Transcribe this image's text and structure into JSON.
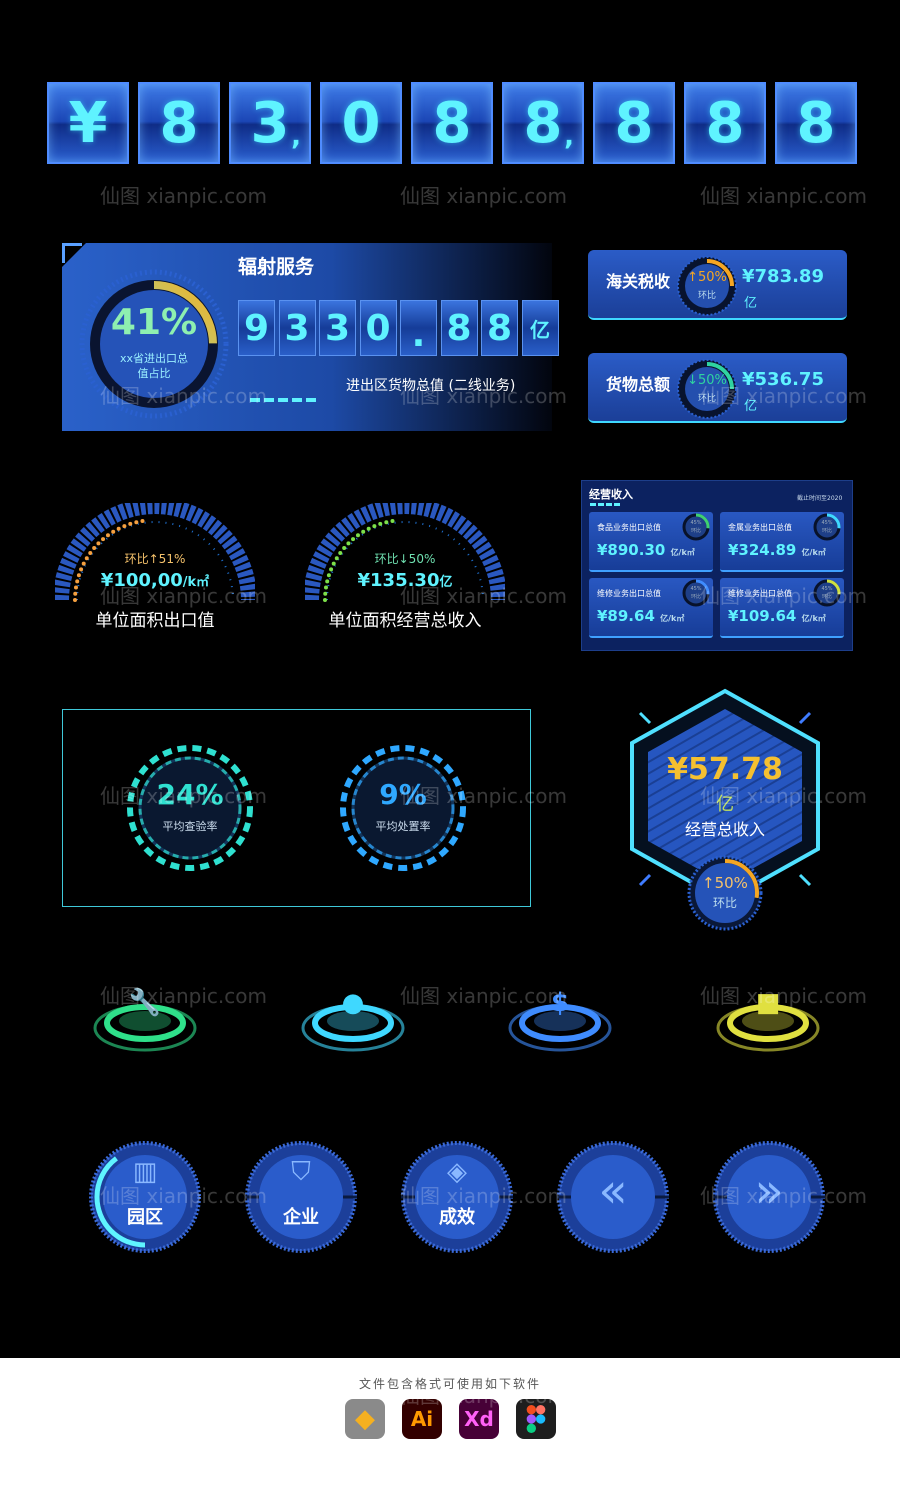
{
  "big_counter": {
    "digits": [
      "¥",
      "8",
      "3",
      "0",
      "8",
      "8",
      "8",
      "8",
      "8"
    ],
    "separators": {
      "2": ",",
      "5": ","
    }
  },
  "radiation_panel": {
    "title": "辐射服务",
    "percent": "41%",
    "percent_label_1": "xx省进出口总",
    "percent_label_2": "值占比",
    "digits": [
      "9",
      "3",
      "3",
      "0",
      ".",
      "8",
      "8",
      "亿"
    ],
    "caption": "进出区货物总值 (二线业务)"
  },
  "stat_cards": [
    {
      "label": "海关税收",
      "change": "↑50%",
      "change_label": "环比",
      "value": "¥783.89",
      "unit": "亿",
      "ring_color": "#f5a623",
      "progress": 0.25
    },
    {
      "label": "货物总额",
      "change": "↓50%",
      "change_label": "环比",
      "value": "¥536.75",
      "unit": "亿",
      "ring_color": "#2fd3a0",
      "progress": 0.25
    }
  ],
  "half_gauges": [
    {
      "change": "环比↑51%",
      "value": "¥100,00",
      "unit": "/k㎡",
      "label": "单位面积出口值",
      "dot_color": "#f5a040",
      "change_color": "#f5c26b"
    },
    {
      "change": "环比↓50%",
      "value": "¥135.30",
      "unit": "亿",
      "label": "单位面积经营总收入",
      "dot_color": "#7de04a",
      "change_color": "#6fe0b0"
    }
  ],
  "revenue_panel": {
    "title": "经营收入",
    "date": "截止时间至2020",
    "items": [
      {
        "label": "食品业务出口总值",
        "value": "¥890.30",
        "unit": "亿/k㎡",
        "ring": "45%",
        "ring_label": "环比",
        "ring_color": "#3fd070"
      },
      {
        "label": "金属业务出口总值",
        "value": "¥324.89",
        "unit": "亿/k㎡",
        "ring": "45%",
        "ring_label": "环比",
        "ring_color": "#3fd8ff"
      },
      {
        "label": "维修业务出口总值",
        "value": "¥89.64",
        "unit": "亿/k㎡",
        "ring": "45%",
        "ring_label": "环比",
        "ring_color": "#3f8cff"
      },
      {
        "label": "维修业务出口总值",
        "value": "¥109.64",
        "unit": "亿/k㎡",
        "ring": "45%",
        "ring_label": "环比",
        "ring_color": "#d0e040"
      }
    ]
  },
  "rate_rings": [
    {
      "value": "24%",
      "label": "平均查验率",
      "color": "#2fe0d0"
    },
    {
      "value": "9%",
      "label": "平均处置率",
      "color": "#2fa8ff"
    }
  ],
  "hexagon": {
    "value": "¥57.78",
    "unit": "亿",
    "label": "经营总收入",
    "change": "↑50%",
    "change_label": "环比"
  },
  "platform_icons": [
    {
      "icon": "wrench-icon",
      "color": "#2fe08a"
    },
    {
      "icon": "lightbulb-icon",
      "color": "#3fd8ff"
    },
    {
      "icon": "money-bag-icon",
      "color": "#3f8cff"
    },
    {
      "icon": "shopping-bag-icon",
      "color": "#e0e040"
    }
  ],
  "round_buttons": [
    {
      "label": "园区",
      "icon": "building-icon"
    },
    {
      "label": "企业",
      "icon": "enterprise-shield-icon"
    },
    {
      "label": "成效",
      "icon": "layers-icon"
    },
    {
      "label": "",
      "icon": "double-chevron-left-icon"
    },
    {
      "label": "",
      "icon": "double-chevron-right-icon"
    }
  ],
  "footer": {
    "caption": "文件包含格式可使用如下软件",
    "apps": [
      "Sketch",
      "Ai",
      "Xd",
      "Figma"
    ]
  },
  "watermark": "仙图 xianpic.com"
}
